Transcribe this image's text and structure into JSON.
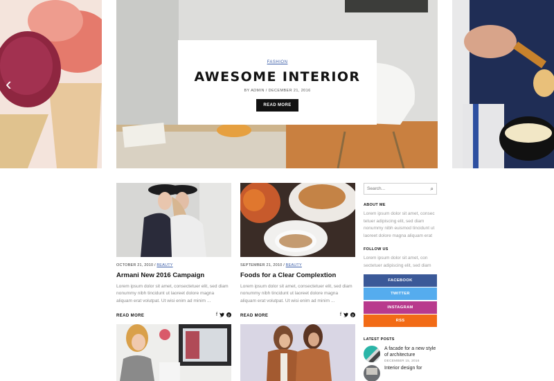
{
  "hero": {
    "category": "FASHION",
    "title": "AWESOME INTERIOR",
    "meta": "BY ADMIN / DECEMBER 21, 2016",
    "button": "READ MORE"
  },
  "posts": [
    {
      "date": "OCTOBER 21, 2010 / ",
      "category": "BEAUTY",
      "title": "Armani New 2016 Campaign",
      "excerpt": "Lorem ipsum dolor sit amet, consectetuer elit, sed diam nonummy nibh tincidunt ut laoreet dolore magna aliquam erat volutpat. Ut wisi enim ad minim ...",
      "read_more": "READ MORE"
    },
    {
      "date": "SEPTEMBER 21, 2010 / ",
      "category": "BEAUTY",
      "title": "Foods for a Clear Complextion",
      "excerpt": "Lorem ipsum dolor sit amet, consectetuer elit, sed diam nonummy nibh tincidunt ut laoreet dolore magna aliquam erat volutpat. Ut wisi enim ad minim ...",
      "read_more": "READ MORE"
    }
  ],
  "social_mini": {
    "facebook": "f",
    "twitter": "♥",
    "pinterest": "℗"
  },
  "sidebar": {
    "search_placeholder": "Search...",
    "about_title": "ABOUT ME",
    "about_text": "Lorem ipsum dolor sit amet, consec tetuer adipiscing elit, sed diam nonummy nibh euismod tincidunt ut laoreet dolore magna aliquam erat",
    "follow_title": "FOLLOW US",
    "follow_text": "Lorem ipsum dolor sit amet, con sectetuer adipiscing elit, sed diam",
    "follow_buttons": [
      {
        "label": "FACEBOOK",
        "color": "#3b5998"
      },
      {
        "label": "TWITTER",
        "color": "#55acee"
      },
      {
        "label": "INSTAGRAM",
        "color": "#b83a8d"
      },
      {
        "label": "RSS",
        "color": "#f26b16"
      }
    ],
    "latest_title": "LATEST POSTS",
    "latest": [
      {
        "title": "A facade for a new style of architecture",
        "date": "DECEMBER 15, 2016"
      },
      {
        "title": "Interior design for"
      }
    ]
  },
  "icons": {
    "prev": "‹",
    "search": "⌕"
  }
}
